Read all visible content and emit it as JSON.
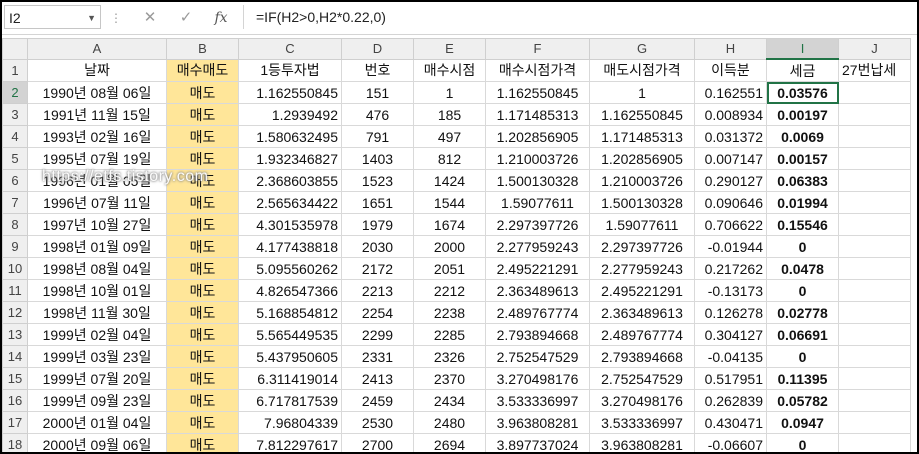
{
  "formula_bar": {
    "name_box": "I2",
    "formula": "=IF(H2>0,H2*0.22,0)",
    "cancel_icon": "✕",
    "enter_icon": "✓",
    "fx_label": "fx"
  },
  "columns": [
    "A",
    "B",
    "C",
    "D",
    "E",
    "F",
    "G",
    "H",
    "I",
    "J"
  ],
  "selected_column": "I",
  "header_row": {
    "row_num": "1",
    "cells": [
      "날짜",
      "매수매도",
      "1등투자법",
      "번호",
      "매수시점",
      "매수시점가격",
      "매도시점가격",
      "이득분",
      "세금",
      "27번납세"
    ]
  },
  "rows": [
    {
      "n": "2",
      "cells": [
        "1990년 08월 06일",
        "매도",
        "1.162550845",
        "151",
        "1",
        "1.162550845",
        "1",
        "0.162551",
        "0.03576",
        ""
      ]
    },
    {
      "n": "3",
      "cells": [
        "1991년 11월 15일",
        "매도",
        "1.2939492",
        "476",
        "185",
        "1.171485313",
        "1.162550845",
        "0.008934",
        "0.00197",
        ""
      ]
    },
    {
      "n": "4",
      "cells": [
        "1993년 02월 16일",
        "매도",
        "1.580632495",
        "791",
        "497",
        "1.202856905",
        "1.171485313",
        "0.031372",
        "0.0069",
        ""
      ]
    },
    {
      "n": "5",
      "cells": [
        "1995년 07월 19일",
        "매도",
        "1.932346827",
        "1403",
        "812",
        "1.210003726",
        "1.202856905",
        "0.007147",
        "0.00157",
        ""
      ]
    },
    {
      "n": "6",
      "cells": [
        "1996년 01월 05일",
        "매도",
        "2.368603855",
        "1523",
        "1424",
        "1.500130328",
        "1.210003726",
        "0.290127",
        "0.06383",
        ""
      ]
    },
    {
      "n": "7",
      "cells": [
        "1996년 07월 11일",
        "매도",
        "2.565634422",
        "1651",
        "1544",
        "1.59077611",
        "1.500130328",
        "0.090646",
        "0.01994",
        ""
      ]
    },
    {
      "n": "8",
      "cells": [
        "1997년 10월 27일",
        "매도",
        "4.301535978",
        "1979",
        "1674",
        "2.297397726",
        "1.59077611",
        "0.706622",
        "0.15546",
        ""
      ]
    },
    {
      "n": "9",
      "cells": [
        "1998년 01월 09일",
        "매도",
        "4.177438818",
        "2030",
        "2000",
        "2.277959243",
        "2.297397726",
        "-0.01944",
        "0",
        ""
      ]
    },
    {
      "n": "10",
      "cells": [
        "1998년 08월 04일",
        "매도",
        "5.095560262",
        "2172",
        "2051",
        "2.495221291",
        "2.277959243",
        "0.217262",
        "0.0478",
        ""
      ]
    },
    {
      "n": "11",
      "cells": [
        "1998년 10월 01일",
        "매도",
        "4.826547366",
        "2213",
        "2212",
        "2.363489613",
        "2.495221291",
        "-0.13173",
        "0",
        ""
      ]
    },
    {
      "n": "12",
      "cells": [
        "1998년 11월 30일",
        "매도",
        "5.168854812",
        "2254",
        "2238",
        "2.489767774",
        "2.363489613",
        "0.126278",
        "0.02778",
        ""
      ]
    },
    {
      "n": "13",
      "cells": [
        "1999년 02월 04일",
        "매도",
        "5.565449535",
        "2299",
        "2285",
        "2.793894668",
        "2.489767774",
        "0.304127",
        "0.06691",
        ""
      ]
    },
    {
      "n": "14",
      "cells": [
        "1999년 03월 23일",
        "매도",
        "5.437950605",
        "2331",
        "2326",
        "2.752547529",
        "2.793894668",
        "-0.04135",
        "0",
        ""
      ]
    },
    {
      "n": "15",
      "cells": [
        "1999년 07월 20일",
        "매도",
        "6.311419014",
        "2413",
        "2370",
        "3.270498176",
        "2.752547529",
        "0.517951",
        "0.11395",
        ""
      ]
    },
    {
      "n": "16",
      "cells": [
        "1999년 09월 23일",
        "매도",
        "6.717817539",
        "2459",
        "2434",
        "3.533336997",
        "3.270498176",
        "0.262839",
        "0.05782",
        ""
      ]
    },
    {
      "n": "17",
      "cells": [
        "2000년 01월 04일",
        "매도",
        "7.96804339",
        "2530",
        "2480",
        "3.963808281",
        "3.533336997",
        "0.430471",
        "0.0947",
        ""
      ]
    },
    {
      "n": "18",
      "cells": [
        "2000년 09월 06일",
        "매도",
        "7.812297617",
        "2700",
        "2694",
        "3.897737024",
        "3.963808281",
        "-0.06607",
        "0",
        ""
      ]
    }
  ],
  "watermark": "https://etfs.tistory.com"
}
